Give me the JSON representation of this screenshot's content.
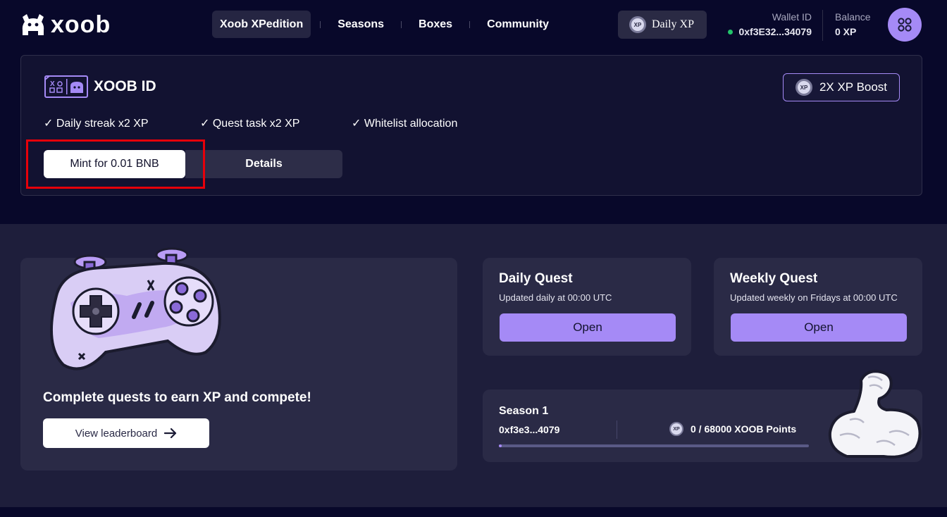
{
  "header": {
    "logo_text": "xoob",
    "nav": [
      {
        "label": "Xoob XPedition",
        "active": true
      },
      {
        "label": "Seasons",
        "active": false
      },
      {
        "label": "Boxes",
        "active": false
      },
      {
        "label": "Community",
        "active": false
      }
    ],
    "daily_xp_label": "Daily XP",
    "xp_coin_text": "XP",
    "wallet_label": "Wallet ID",
    "wallet_value": "0xf3E32...34079",
    "balance_label": "Balance",
    "balance_value": "0 XP",
    "menu_icon": "grid-dots-icon"
  },
  "id_card": {
    "title": "XOOB ID",
    "boost_label": "2X XP Boost",
    "perks": [
      "✓ Daily streak x2 XP",
      "✓ Quest task x2 XP",
      "✓ Whitelist allocation"
    ],
    "mint_label": "Mint for 0.01 BNB",
    "details_label": "Details"
  },
  "quests": {
    "tagline": "Complete quests to earn XP and compete!",
    "leaderboard_label": "View leaderboard",
    "daily": {
      "title": "Daily Quest",
      "subtitle": "Updated daily at 00:00 UTC",
      "button": "Open"
    },
    "weekly": {
      "title": "Weekly Quest",
      "subtitle": "Updated weekly on Fridays at 00:00 UTC",
      "button": "Open"
    }
  },
  "season": {
    "title": "Season 1",
    "wallet": "0xf3e3...4079",
    "points": "0 / 68000 XOOB Points",
    "progress": 1
  },
  "colors": {
    "background": "#08082a",
    "accent": "#a58af6",
    "highlight": "#e6000a",
    "online": "#22c46a"
  }
}
